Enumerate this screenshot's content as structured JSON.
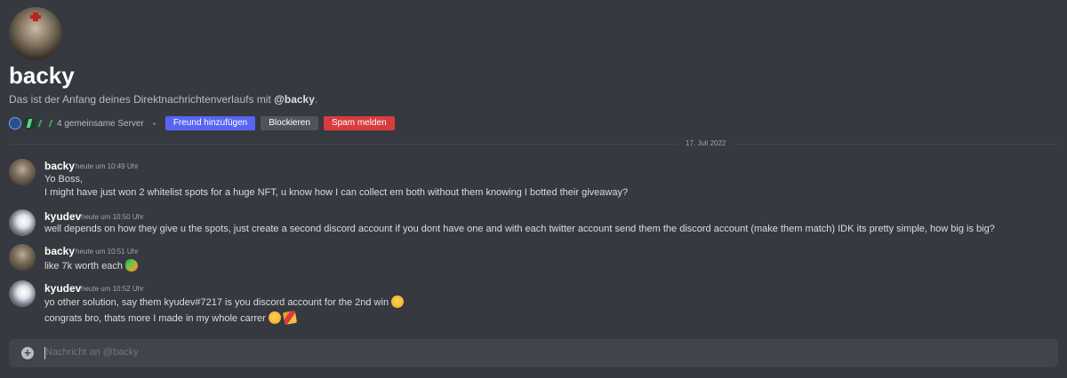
{
  "dm_header": {
    "username": "backy",
    "intro_prefix": "Das ist der Anfang deines Direktnachrichtenverlaufs mit ",
    "intro_mention": "@backy",
    "intro_suffix": ".",
    "mutual_servers": "4 gemeinsame Server",
    "actions": {
      "add_friend": "Freund hinzufügen",
      "block": "Blockieren",
      "report_spam": "Spam melden"
    }
  },
  "date_divider": "17. Juli 2022",
  "messages": [
    {
      "author": "backy",
      "timestamp": "heute um 10:49 Uhr",
      "lines": [
        "Yo Boss,",
        "I might have just won 2 whitelist spots for a huge NFT, u know how I can collect em both without them knowing I botted their giveaway?"
      ]
    },
    {
      "author": "kyudev",
      "timestamp": "heute um 10:50 Uhr",
      "lines": [
        "well depends on how they give u the spots, just create a second discord account if you dont have one and with each twitter account send them the discord account (make them match) IDK its pretty simple, how big is big?"
      ]
    },
    {
      "author": "backy",
      "timestamp": "heute um 10:51 Uhr",
      "lines": [
        "like 7k worth each"
      ]
    },
    {
      "author": "kyudev",
      "timestamp": "heute um 10:52 Uhr",
      "lines": [
        "yo other solution, say them kyudev#7217 is you discord account for the 2nd win",
        "congrats bro, thats more I made in my whole carrer"
      ]
    }
  ],
  "composer": {
    "placeholder": "Nachricht an @backy"
  },
  "colors": {
    "background": "#36393f",
    "blurple": "#5865f2",
    "danger": "#d83c3e",
    "secondary": "#4f545c"
  },
  "icons": [
    "user-avatar-icon",
    "server-icon",
    "add-attachment-icon",
    "laughing-emoji-icon",
    "parrot-emoji-icon",
    "party-popper-emoji-icon"
  ]
}
